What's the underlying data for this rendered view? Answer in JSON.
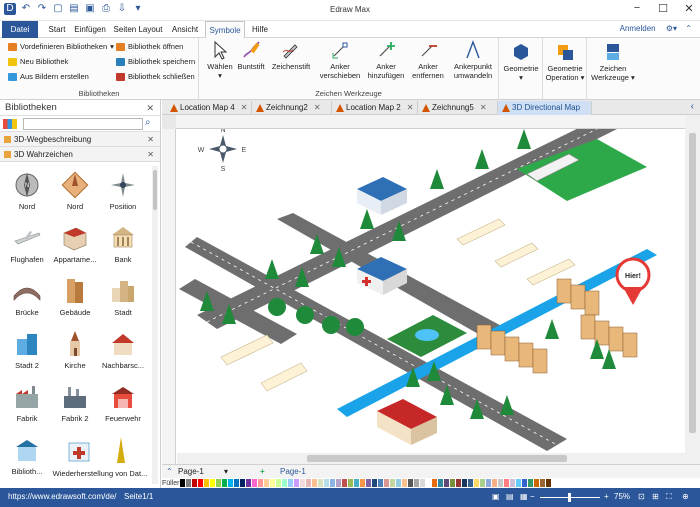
{
  "app": {
    "title": "Edraw Max"
  },
  "menu": {
    "file": "Datei",
    "tabs": [
      "Start",
      "Einfügen",
      "Seiten Layout",
      "Ansicht",
      "Symbole",
      "Hilfe"
    ],
    "active": "Symbole",
    "login": "Anmelden"
  },
  "ribbon": {
    "libraries": {
      "predefined": "Vordefinieren Bibliotheken",
      "new": "Neu Bibliothek",
      "from_images": "Aus Bildern erstellen",
      "open": "Bibliothek öffnen",
      "save": "Bibliothek speichern",
      "close": "Bibliothek schließen",
      "group": "Bibliotheken"
    },
    "tools": {
      "select": "Wählen",
      "crayon": "Buntstift",
      "pen": "Zeichenstift",
      "anchor_move": "Anker verschieben",
      "anchor_add": "Anker hinzufügen",
      "anchor_remove": "Anker entfernen",
      "anchor_convert": "Ankerpunkt umwandeln",
      "group": "Zeichen Werkzeuge"
    },
    "geometry": {
      "geometry": "Geometrie",
      "operation": "Geometrie Operation",
      "tools": "Zeichen Werkzeuge"
    }
  },
  "sidebar": {
    "title": "Bibliotheken",
    "categories": [
      "3D-Wegbeschreibung",
      "3D Wahrzeichen"
    ],
    "shapes": [
      "Nord",
      "Nord",
      "Position",
      "Flughafen",
      "Appartame...",
      "Bank",
      "Brücke",
      "Gebäude",
      "Stadt",
      "Stadt 2",
      "Kirche",
      "Nachbarsc...",
      "Fabrik",
      "Fabrik 2",
      "Feuerwehr",
      "Biblioth...",
      "Wiederherstellung von Dat..."
    ]
  },
  "doc_tabs": [
    {
      "label": "Location Map 4",
      "active": false
    },
    {
      "label": "Zeichnung2",
      "active": false
    },
    {
      "label": "Location Map 2",
      "active": false
    },
    {
      "label": "Zeichnung5",
      "active": false
    },
    {
      "label": "3D Directional Map",
      "active": true
    }
  ],
  "canvas": {
    "compass": {
      "n": "N",
      "s": "S",
      "w": "W",
      "e": "E"
    },
    "pin_label": "Hier!"
  },
  "pages": {
    "current": "Page-1",
    "tab": "Page-1"
  },
  "colorbar": {
    "label": "Füller",
    "colors": [
      "#000000",
      "#7f7f7f",
      "#c00000",
      "#ff0000",
      "#ffc000",
      "#ffff00",
      "#92d050",
      "#00b050",
      "#00b0f0",
      "#0070c0",
      "#002060",
      "#7030a0",
      "#ff66cc",
      "#ff9999",
      "#ffcc99",
      "#ffff99",
      "#ccff99",
      "#99ffcc",
      "#99ccff",
      "#cc99ff",
      "#f2dcdb",
      "#e6b9b8",
      "#fac090",
      "#d7e4bd",
      "#b7dee8",
      "#8eb4e3",
      "#b3a2c7",
      "#c0504d",
      "#9bbb59",
      "#4bacc6",
      "#f79646",
      "#8064a2",
      "#1f497d",
      "#4f81bd",
      "#d99694",
      "#c3d69b",
      "#93cddd",
      "#fabf8f",
      "#595959",
      "#a6a6a6",
      "#d9d9d9",
      "#ffffff",
      "#e46c0a",
      "#31859c",
      "#5f497a",
      "#76923c",
      "#953735",
      "#17375e",
      "#366092",
      "#ffd966",
      "#a9d08e",
      "#8ea9db",
      "#f4b084",
      "#c9c9c9",
      "#ff7c80",
      "#ccc0da",
      "#66ccff",
      "#3366cc",
      "#339966",
      "#cc6600",
      "#996633",
      "#663300"
    ]
  },
  "status": {
    "url": "https://www.edrawsoft.com/de/",
    "page": "Seite1/1",
    "zoom": "75%"
  }
}
